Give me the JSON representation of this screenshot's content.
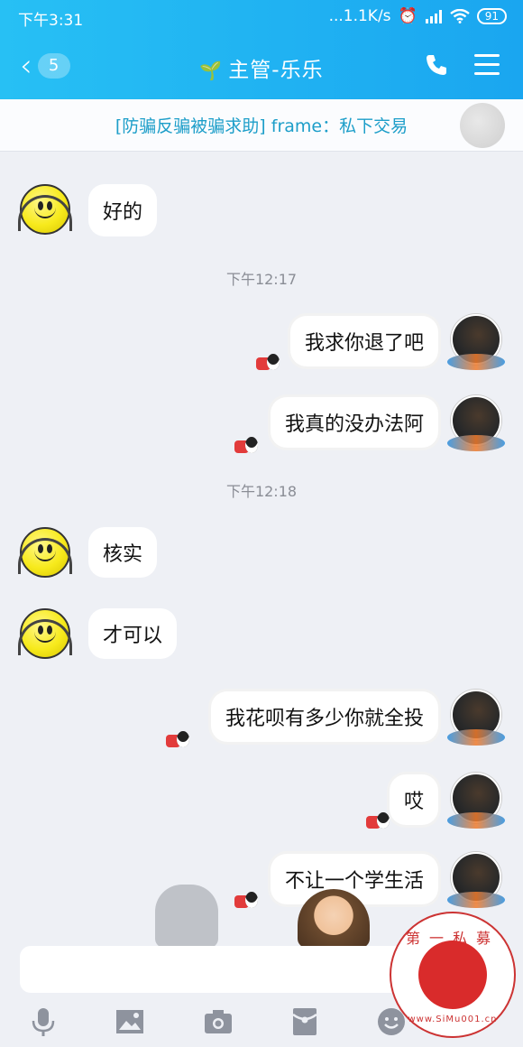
{
  "status_bar": {
    "time": "下午3:31",
    "network": "...1.1K/s",
    "battery": "91"
  },
  "header": {
    "back_badge": "5",
    "title": "主管-乐乐"
  },
  "banner": {
    "text": "[防骗反骗被骗求助] frame：私下交易"
  },
  "messages": [
    {
      "side": "left",
      "text": "好的"
    },
    {
      "side": "right",
      "text": "我求你退了吧"
    },
    {
      "side": "right",
      "text": "我真的没办法阿"
    },
    {
      "side": "left",
      "text": "核实"
    },
    {
      "side": "left",
      "text": "才可以"
    },
    {
      "side": "right",
      "text": "我花呗有多少你就全投"
    },
    {
      "side": "right",
      "text": "哎"
    },
    {
      "side": "right",
      "text": "不让一个学生活"
    }
  ],
  "timestamps": [
    "下午12:17",
    "下午12:18"
  ],
  "toolbar": {
    "icons": [
      "microphone-icon",
      "image-icon",
      "camera-icon",
      "red-packet-icon",
      "emoji-icon"
    ]
  },
  "watermark": {
    "top_text": "第一私募",
    "bottom_text": "www.SiMu001.cn"
  }
}
